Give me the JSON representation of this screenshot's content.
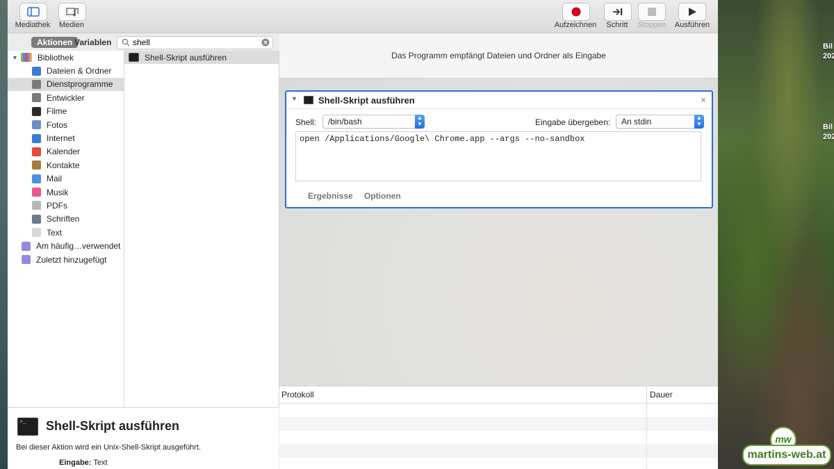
{
  "toolbar": {
    "left": [
      {
        "label": "Mediathek",
        "icon": "library-sidebar-icon"
      },
      {
        "label": "Medien",
        "icon": "media-icon"
      }
    ],
    "right": [
      {
        "label": "Aufzeichnen",
        "icon": "record-icon",
        "enabled": true
      },
      {
        "label": "Schritt",
        "icon": "step-icon",
        "enabled": true
      },
      {
        "label": "Stoppen",
        "icon": "stop-icon",
        "enabled": false
      },
      {
        "label": "Ausführen",
        "icon": "play-icon",
        "enabled": true
      }
    ]
  },
  "library": {
    "tab_actions": "Aktionen",
    "tab_variables": "Variablen",
    "search_value": "shell",
    "root_label": "Bibliothek",
    "categories": [
      {
        "label": "Dateien & Ordner",
        "color": "#3a7bd5"
      },
      {
        "label": "Dienstprogramme",
        "color": "#7a7a7a",
        "selected": true
      },
      {
        "label": "Entwickler",
        "color": "#7a7a7a"
      },
      {
        "label": "Filme",
        "color": "#2a2a2a"
      },
      {
        "label": "Fotos",
        "color": "#6a8fc4"
      },
      {
        "label": "Internet",
        "color": "#3a7bd5"
      },
      {
        "label": "Kalender",
        "color": "#e04a3a"
      },
      {
        "label": "Kontakte",
        "color": "#a97a3e"
      },
      {
        "label": "Mail",
        "color": "#4a90e2"
      },
      {
        "label": "Musik",
        "color": "#e85a8a"
      },
      {
        "label": "PDFs",
        "color": "#b8b8b8"
      },
      {
        "label": "Schriften",
        "color": "#6a7a8a"
      },
      {
        "label": "Text",
        "color": "#d8d8d8"
      }
    ],
    "extra": [
      {
        "label": "Am häufig…verwendet",
        "color": "#9a88e0"
      },
      {
        "label": "Zuletzt hinzugefügt",
        "color": "#9a88e0"
      }
    ],
    "actions": [
      "Shell-Skript ausführen"
    ]
  },
  "description": {
    "title": "Shell-Skript ausführen",
    "text": "Bei dieser Aktion wird ein Unix-Shell-Skript ausgeführt.",
    "input_label": "Eingabe:",
    "input_value": "Text"
  },
  "workflow": {
    "header": "Das Programm empfängt Dateien und Ordner als Eingabe",
    "action": {
      "title": "Shell-Skript ausführen",
      "shell_label": "Shell:",
      "shell_value": "/bin/bash",
      "pass_input_label": "Eingabe übergeben:",
      "pass_input_value": "An stdin",
      "script": "open /Applications/Google\\ Chrome.app --args --no-sandbox",
      "tab_results": "Ergebnisse",
      "tab_options": "Optionen"
    }
  },
  "log": {
    "col_log": "Protokoll",
    "col_duration": "Dauer"
  },
  "desktop": {
    "labels": [
      "Bil\n202",
      "Bil\n202"
    ],
    "brand_text": "martins-web.at",
    "brand_badge": "mw"
  },
  "colors": {
    "accent": "#2b6fd6",
    "record": "#d0021b"
  }
}
